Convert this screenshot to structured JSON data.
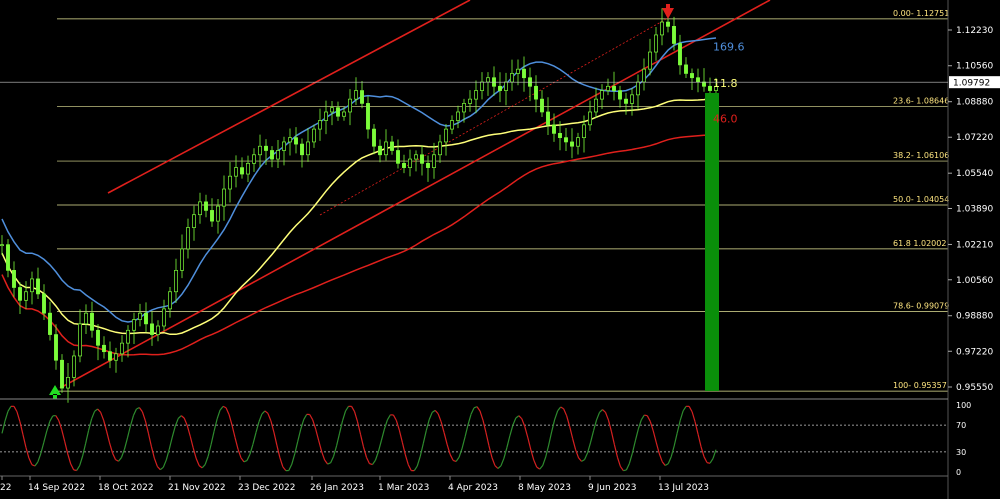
{
  "chart_data": {
    "type": "candlestick",
    "y_axis_ticks": [
      1.1223,
      1.1056,
      1.0888,
      1.0722,
      1.0554,
      1.0389,
      1.0221,
      1.0056,
      0.9888,
      0.9722,
      0.9555
    ],
    "current_price_label": "1.09792",
    "current_price": 1.09792,
    "x_axis_labels": [
      "22",
      "14 Sep 2022",
      "18 Oct 2022",
      "21 Nov 2022",
      "23 Dec 2022",
      "26 Jan 2023",
      "1 Mar 2023",
      "4 Apr 2023",
      "8 May 2023",
      "9 Jun 2023",
      "13 Jul 2023"
    ],
    "fibonacci_levels": [
      {
        "label": "0.00- 1.12751",
        "value": 1.12751
      },
      {
        "label": "23.6- 1.08646",
        "value": 1.08646
      },
      {
        "label": "38.2- 1.06106",
        "value": 1.06106
      },
      {
        "label": "50.0- 1.04054",
        "value": 1.04054
      },
      {
        "label": "61.8 1.02002",
        "value": 1.02002
      },
      {
        "label": "78.6- 0.99079",
        "value": 0.99079
      },
      {
        "label": "100- 0.95357",
        "value": 0.95357
      }
    ],
    "moving_average_labels": [
      {
        "text": "169.6",
        "color": "#4f8fdc",
        "value": 1.1145
      },
      {
        "text": "11.8",
        "color": "#ffff7a",
        "value": 1.0975
      },
      {
        "text": "46.0",
        "color": "#e0201c",
        "value": 1.081
      }
    ],
    "oscillator_ticks": [
      "100",
      "70",
      "30",
      "0"
    ],
    "oscillator_levels": [
      100,
      70,
      30,
      0
    ],
    "colors": {
      "background": "#000000",
      "candle": "#7cfc3a",
      "ma_blue": "#4f8fdc",
      "ma_yellow": "#ffff7a",
      "ma_red": "#e0201c",
      "channel": "#e0201c",
      "fib_line": "#ffffaa",
      "target_bar": "#0a8f0a",
      "down_arrow": "#e0201c",
      "up_arrow": "#22dd22"
    },
    "price_series": [
      1.022,
      1.01,
      1.002,
      0.996,
      1.0,
      1.006,
      0.999,
      0.99,
      0.98,
      0.968,
      0.955,
      0.96,
      0.97,
      0.985,
      0.99,
      0.982,
      0.975,
      0.972,
      0.968,
      0.971,
      0.976,
      0.982,
      0.987,
      0.99,
      0.985,
      0.98,
      0.984,
      0.992,
      1.0,
      1.01,
      1.02,
      1.03,
      1.036,
      1.042,
      1.038,
      1.033,
      1.04,
      1.048,
      1.054,
      1.058,
      1.055,
      1.06,
      1.064,
      1.068,
      1.066,
      1.062,
      1.066,
      1.07,
      1.072,
      1.069,
      1.064,
      1.07,
      1.076,
      1.08,
      1.084,
      1.086,
      1.082,
      1.084,
      1.09,
      1.094,
      1.088,
      1.076,
      1.068,
      1.064,
      1.07,
      1.066,
      1.06,
      1.058,
      1.062,
      1.064,
      1.06,
      1.058,
      1.064,
      1.07,
      1.076,
      1.08,
      1.084,
      1.088,
      1.09,
      1.094,
      1.098,
      1.1,
      1.096,
      1.094,
      1.098,
      1.102,
      1.104,
      1.1,
      1.096,
      1.09,
      1.084,
      1.078,
      1.074,
      1.072,
      1.07,
      1.068,
      1.072,
      1.078,
      1.084,
      1.09,
      1.094,
      1.096,
      1.094,
      1.09,
      1.088,
      1.092,
      1.098,
      1.104,
      1.112,
      1.12,
      1.126,
      1.124,
      1.116,
      1.106,
      1.102,
      1.1,
      1.098,
      1.096,
      1.094,
      1.096
    ]
  }
}
